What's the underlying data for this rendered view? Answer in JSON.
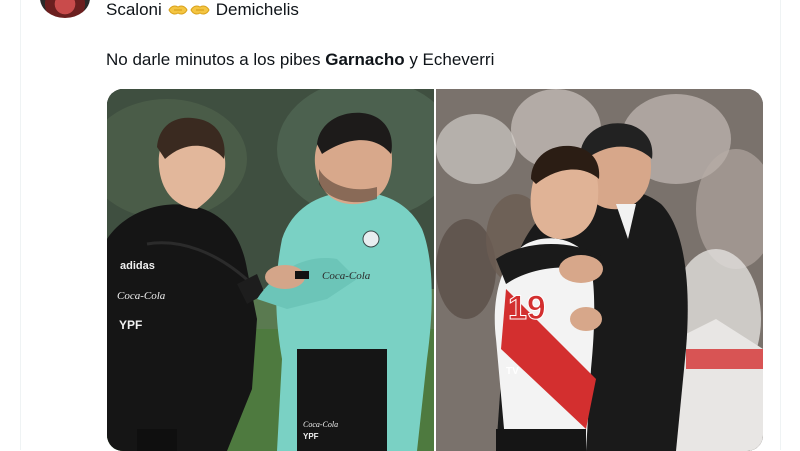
{
  "tweet": {
    "author_name": "Scaloni",
    "mentioned_name": "Demichelis",
    "emoji_icon": "handshake-emoji",
    "text_prefix": "No darle minutos a los pibes ",
    "text_bold": "Garnacho",
    "text_suffix": " y Echeverri"
  },
  "media": {
    "left_photo": {
      "shirt_brand_1": "adidas",
      "shirt_sponsor_1": "Coca-Cola",
      "shirt_sponsor_2": "YPF",
      "coach_shirt_sponsor": "Coca-Cola",
      "shorts_sponsor_1": "Coca-Cola",
      "shorts_sponsor_2": "YPF"
    },
    "right_photo": {
      "shirt_number": "19",
      "shirt_sponsor": "TV"
    }
  },
  "colors": {
    "text": "#0f1419",
    "border": "#eff3f4",
    "argentina_training_teal": "#7ad1c4",
    "river_red": "#d32f2f"
  }
}
